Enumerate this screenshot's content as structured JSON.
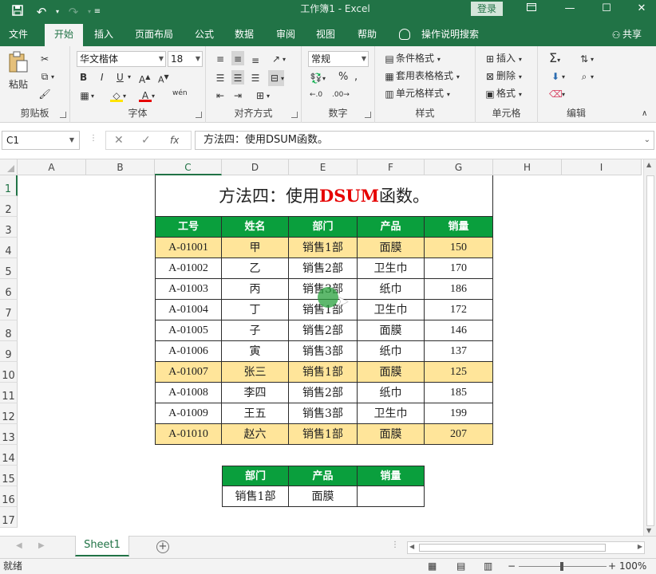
{
  "window": {
    "title": "工作簿1  -  Excel",
    "login_label": "登录"
  },
  "ribbon_tabs": [
    "文件",
    "开始",
    "插入",
    "页面布局",
    "公式",
    "数据",
    "审阅",
    "视图",
    "帮助"
  ],
  "tell_me": "操作说明搜索",
  "share_label": "共享",
  "ribbon": {
    "clipboard": {
      "paste_label": "粘贴",
      "group_label": "剪贴板"
    },
    "font": {
      "font_name": "华文楷体",
      "font_size": "18",
      "bold": "B",
      "italic": "I",
      "underline": "U",
      "font_color_glyph": "A",
      "phonetic": "wén",
      "group_label": "字体"
    },
    "alignment": {
      "group_label": "对齐方式"
    },
    "number": {
      "format": "常规",
      "percent": "%",
      "group_label": "数字"
    },
    "styles": {
      "conditional": "条件格式",
      "table_format": "套用表格格式",
      "cell_styles": "单元格样式",
      "group_label": "样式"
    },
    "cells": {
      "insert": "插入",
      "delete": "删除",
      "format": "格式",
      "group_label": "单元格"
    },
    "editing": {
      "group_label": "编辑"
    }
  },
  "formula_bar": {
    "name_box": "C1",
    "fx": "fx",
    "content": "方法四：使用DSUM函数。"
  },
  "columns": [
    "A",
    "B",
    "C",
    "D",
    "E",
    "F",
    "G",
    "H",
    "I"
  ],
  "rows": [
    "1",
    "2",
    "3",
    "4",
    "5",
    "6",
    "7",
    "8",
    "9",
    "10",
    "11",
    "12",
    "13",
    "14",
    "15",
    "16",
    "17"
  ],
  "sheet": {
    "title_prefix": "方法四：使用",
    "title_highlight": "DSUM",
    "title_suffix": "函数。",
    "title_highlight_color": "#e60000",
    "header_color": "#0a9f3d",
    "highlight_row_color": "#ffe59a",
    "table_headers": [
      "工号",
      "姓名",
      "部门",
      "产品",
      "销量"
    ],
    "table_rows": [
      {
        "id": "A-01001",
        "name": "甲",
        "dept": "销售1部",
        "product": "面膜",
        "sales": "150"
      },
      {
        "id": "A-01002",
        "name": "乙",
        "dept": "销售2部",
        "product": "卫生巾",
        "sales": "170"
      },
      {
        "id": "A-01003",
        "name": "丙",
        "dept": "销售3部",
        "product": "纸巾",
        "sales": "186"
      },
      {
        "id": "A-01004",
        "name": "丁",
        "dept": "销售1部",
        "product": "卫生巾",
        "sales": "172"
      },
      {
        "id": "A-01005",
        "name": "子",
        "dept": "销售2部",
        "product": "面膜",
        "sales": "146"
      },
      {
        "id": "A-01006",
        "name": "寅",
        "dept": "销售3部",
        "product": "纸巾",
        "sales": "137"
      },
      {
        "id": "A-01007",
        "name": "张三",
        "dept": "销售1部",
        "product": "面膜",
        "sales": "125"
      },
      {
        "id": "A-01008",
        "name": "李四",
        "dept": "销售2部",
        "product": "纸巾",
        "sales": "185"
      },
      {
        "id": "A-01009",
        "name": "王五",
        "dept": "销售3部",
        "product": "卫生巾",
        "sales": "199"
      },
      {
        "id": "A-01010",
        "name": "赵六",
        "dept": "销售1部",
        "product": "面膜",
        "sales": "207"
      }
    ],
    "highlighted_rows": [
      0,
      6,
      9
    ],
    "criteria_headers": [
      "部门",
      "产品",
      "销量"
    ],
    "criteria_values": [
      "销售1部",
      "面膜",
      ""
    ]
  },
  "sheet_tab": "Sheet1",
  "status": {
    "ready": "就绪",
    "zoom": "100%"
  }
}
